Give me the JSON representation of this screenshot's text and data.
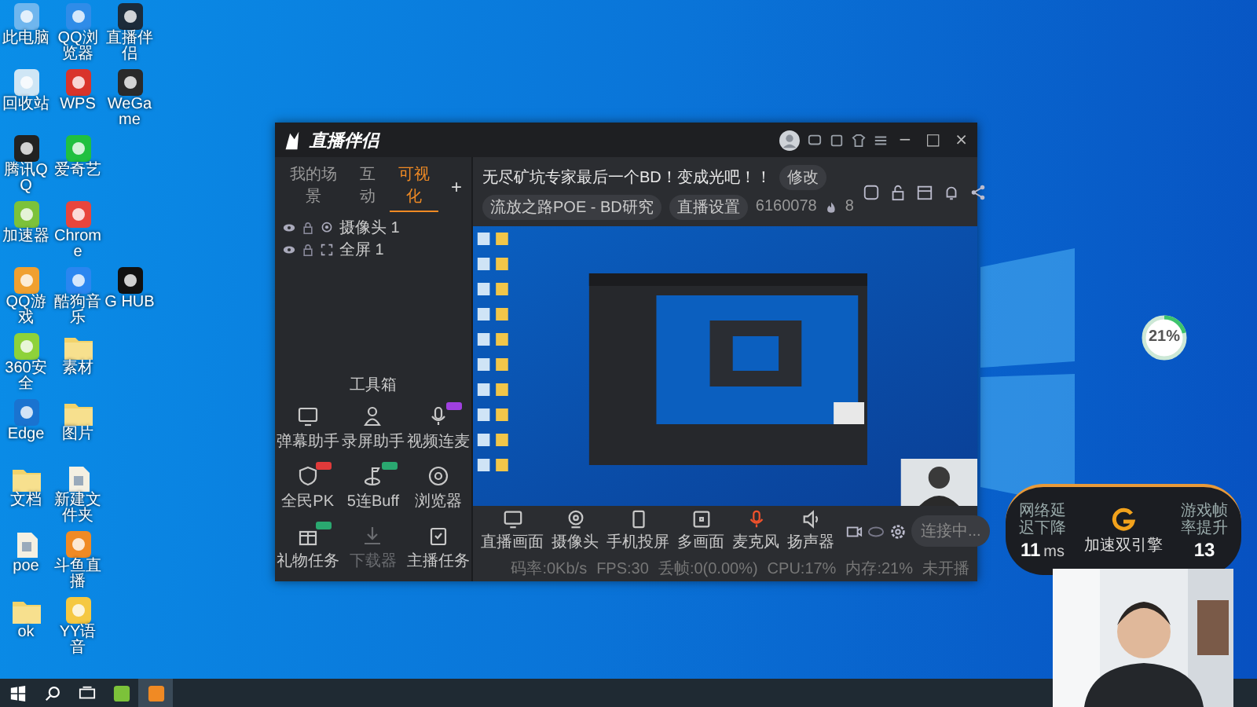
{
  "desktop": {
    "icon_rows": [
      [
        {
          "label": "此电脑",
          "kind": "app",
          "color": "#6fb6ee"
        },
        {
          "label": "QQ浏览器",
          "kind": "app",
          "color": "#2f8ce8"
        },
        {
          "label": "直播伴侣",
          "kind": "app",
          "color": "#1c2b3a"
        }
      ],
      [
        {
          "label": "回收站",
          "kind": "app",
          "color": "#cfe6f5"
        },
        {
          "label": "WPS",
          "kind": "app",
          "color": "#d9342b"
        },
        {
          "label": "WeGame",
          "kind": "app",
          "color": "#2a2a2a"
        }
      ],
      [
        {
          "label": "腾讯QQ",
          "kind": "app",
          "color": "#222222"
        },
        {
          "label": "爱奇艺",
          "kind": "app",
          "color": "#20c040"
        }
      ],
      [
        {
          "label": "加速器",
          "kind": "app",
          "color": "#7cc23a"
        },
        {
          "label": "Chrome",
          "kind": "app",
          "color": "#e8453c"
        }
      ],
      [
        {
          "label": "QQ游戏",
          "kind": "app",
          "color": "#f0a030"
        },
        {
          "label": "酷狗音乐",
          "kind": "app",
          "color": "#2a86f0"
        },
        {
          "label": "G HUB",
          "kind": "app",
          "color": "#111111"
        }
      ],
      [
        {
          "label": "360安全",
          "kind": "app",
          "color": "#8ed23a"
        },
        {
          "label": "素材",
          "kind": "folder"
        }
      ],
      [
        {
          "label": "Edge",
          "kind": "app",
          "color": "#1a73d0"
        },
        {
          "label": "图片",
          "kind": "folder"
        }
      ],
      [
        {
          "label": "文档",
          "kind": "folder"
        },
        {
          "label": "新建文件夹",
          "kind": "file"
        }
      ],
      [
        {
          "label": "poe",
          "kind": "file"
        },
        {
          "label": "斗鱼直播",
          "kind": "app",
          "color": "#f08a24"
        }
      ],
      [
        {
          "label": "ok",
          "kind": "folder"
        },
        {
          "label": "YY语音",
          "kind": "app",
          "color": "#f5c842"
        }
      ]
    ]
  },
  "window": {
    "app_name": "直播伴侣",
    "window_controls": [
      "−",
      "□",
      "×"
    ],
    "tabs": [
      {
        "label": "我的场景",
        "selected": false
      },
      {
        "label": "互动",
        "selected": false
      },
      {
        "label": "可视化",
        "selected": true
      }
    ],
    "add_button": "+",
    "scenes": [
      {
        "label": "摄像头 1",
        "kind": "camera"
      },
      {
        "label": "全屏 1",
        "kind": "screen"
      }
    ],
    "toolbox_title": "工具箱",
    "tools": [
      {
        "label": "弹幕助手",
        "kind": "monitor",
        "disabled": false
      },
      {
        "label": "录屏助手",
        "kind": "person",
        "disabled": false
      },
      {
        "label": "视频连麦",
        "kind": "mic",
        "disabled": false,
        "badge": {
          "color": "#a040e0"
        }
      },
      {
        "label": "全民PK",
        "kind": "shield",
        "disabled": false,
        "badge": {
          "color": "#e03a3a"
        }
      },
      {
        "label": "5连Buff",
        "kind": "flag",
        "disabled": false,
        "badge": {
          "color": "#2aa870"
        }
      },
      {
        "label": "浏览器",
        "kind": "compass",
        "disabled": false
      },
      {
        "label": "礼物任务",
        "kind": "gift",
        "disabled": false,
        "badge": {
          "color": "#2aa870"
        }
      },
      {
        "label": "下载器",
        "kind": "download",
        "disabled": true
      },
      {
        "label": "主播任务",
        "kind": "clipboard",
        "disabled": false
      }
    ],
    "stream_title": "无尽矿坑专家最后一个BD！变成光吧！！",
    "edit_button": "修改",
    "category": "流放之路POE - BD研究",
    "settings_button": "直播设置",
    "room_number": "6160078",
    "fire_count": "8",
    "controls": [
      {
        "label": "直播画面",
        "kind": "screen",
        "active": false
      },
      {
        "label": "摄像头",
        "kind": "camera",
        "active": false
      },
      {
        "label": "手机投屏",
        "kind": "phone",
        "active": false
      },
      {
        "label": "多画面",
        "kind": "frame",
        "active": false
      },
      {
        "label": "麦克风",
        "kind": "mic",
        "active": true
      },
      {
        "label": "扬声器",
        "kind": "speaker",
        "active": false
      }
    ],
    "go_live_button": "连接中...",
    "status": [
      "码率:0Kb/s",
      "FPS:30",
      "丢帧:0(0.00%)",
      "CPU:17%",
      "内存:21%",
      "未开播"
    ]
  },
  "net_meter": {
    "reading": "21%",
    "level": 0.21
  },
  "booster": {
    "left_label": "网络延迟下降",
    "left_value": "11",
    "left_unit": "ms",
    "name": "加速双引擎",
    "right_label": "游戏帧率提升",
    "right_value": "13"
  },
  "taskbar": [
    {
      "kind": "start",
      "selected": false
    },
    {
      "kind": "search",
      "selected": false
    },
    {
      "kind": "taskview",
      "selected": false
    },
    {
      "kind": "app",
      "color": "#7cc23a",
      "selected": false
    },
    {
      "kind": "app",
      "color": "#f08a24",
      "selected": true
    }
  ]
}
